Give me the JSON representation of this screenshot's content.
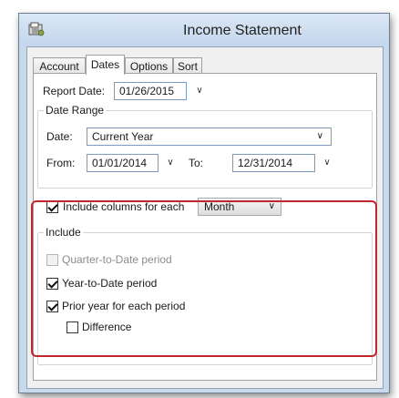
{
  "window": {
    "title": "Income Statement"
  },
  "tabs": [
    {
      "label": "Account"
    },
    {
      "label": "Dates"
    },
    {
      "label": "Options"
    },
    {
      "label": "Sort"
    }
  ],
  "report_date": {
    "label": "Report Date:",
    "value": "01/26/2015"
  },
  "date_range": {
    "legend": "Date Range",
    "date_label": "Date:",
    "date_value": "Current Year",
    "from_label": "From:",
    "from_value": "01/01/2014",
    "to_label": "To:",
    "to_value": "12/31/2014"
  },
  "columns": {
    "label": "Include columns for each",
    "checked": true,
    "period_value": "Month"
  },
  "include": {
    "legend": "Include",
    "items": [
      {
        "label": "Quarter-to-Date period",
        "checked": false,
        "enabled": false
      },
      {
        "label": "Year-to-Date period",
        "checked": true,
        "enabled": true
      },
      {
        "label": "Prior year for each period",
        "checked": true,
        "enabled": true
      },
      {
        "label": "Difference",
        "checked": false,
        "enabled": true
      }
    ]
  },
  "colors": {
    "highlight": "#c0262b",
    "window_frame": "#c9d9ec",
    "field_border": "#7a9cc4"
  }
}
